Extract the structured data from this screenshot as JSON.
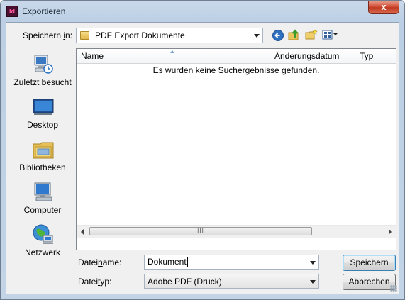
{
  "window": {
    "title": "Exportieren",
    "app_icon_text": "Id",
    "close_symbol": "x"
  },
  "location": {
    "label_prefix": "Speichern ",
    "label_hotkey": "i",
    "label_suffix": "n:",
    "current_folder": "PDF Export Dokumente"
  },
  "toolbar": {
    "icons": [
      "back-icon",
      "up-folder-icon",
      "new-folder-icon",
      "view-menu-icon"
    ]
  },
  "places": [
    {
      "label": "Zuletzt besucht",
      "icon": "recent-places-icon"
    },
    {
      "label": "Desktop",
      "icon": "desktop-icon"
    },
    {
      "label": "Bibliotheken",
      "icon": "libraries-icon"
    },
    {
      "label": "Computer",
      "icon": "computer-icon"
    },
    {
      "label": "Netzwerk",
      "icon": "network-icon"
    }
  ],
  "file_list": {
    "columns": [
      "Name",
      "Änderungsdatum",
      "Typ"
    ],
    "empty_message": "Es wurden keine Suchergebnisse gefunden.",
    "scroll_grip": "III"
  },
  "filename": {
    "label_prefix": "Datei",
    "label_hotkey": "n",
    "label_suffix": "ame:",
    "value": "Dokument"
  },
  "filetype": {
    "label_prefix": "Datei",
    "label_hotkey": "t",
    "label_suffix": "yp:",
    "value": "Adobe PDF (Druck)"
  },
  "buttons": {
    "save": "Speichern",
    "cancel": "Abbrechen"
  },
  "colors": {
    "frame": "#c2d4e6",
    "close_button": "#c8432b",
    "dialog_bg": "#f0f0f0",
    "default_button_border": "#3c7fb1"
  }
}
